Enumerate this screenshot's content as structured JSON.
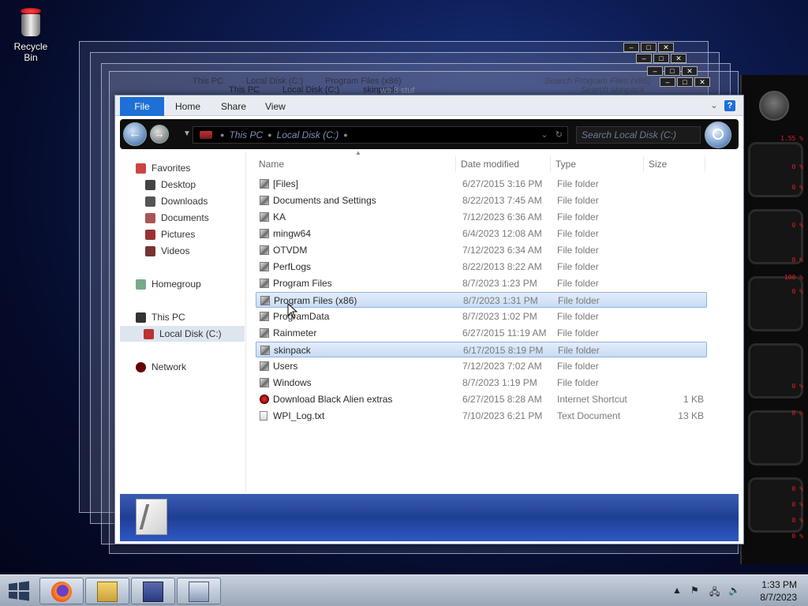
{
  "desktop": {
    "recycle_bin_label": "Recycle Bin"
  },
  "ghost_windows": {
    "crumb_this_pc": "This PC",
    "crumb_local_disk": "Local Disk (C:)",
    "crumb_program_files": "Program Files (x86)",
    "crumb_skinpack": "skinpack",
    "search_program_files": "Search Program Files (x86)",
    "search_skinpack": "Search skinpack",
    "partial_text": "ws 8 stuf"
  },
  "alien_panel": {
    "readouts": [
      "1.55 %",
      "0 %",
      "0 %",
      "0 %",
      "0 %",
      "100 %",
      "0 %",
      "0 %",
      "0 %",
      "0 %",
      "0 %",
      "0 %",
      "0 %",
      "0 %",
      "0 %",
      "0 %"
    ]
  },
  "ribbon": {
    "tabs": [
      "File",
      "Home",
      "Share",
      "View"
    ]
  },
  "nav": {
    "breadcrumbs": [
      "This PC",
      "Local Disk (C:)"
    ],
    "search_placeholder": "Search Local Disk (C:)"
  },
  "sidebar": {
    "favorites": "Favorites",
    "desktop": "Desktop",
    "downloads": "Downloads",
    "documents": "Documents",
    "pictures": "Pictures",
    "videos": "Videos",
    "homegroup": "Homegroup",
    "this_pc": "This PC",
    "local_disk": "Local Disk (C:)",
    "network": "Network"
  },
  "columns": {
    "name": "Name",
    "date": "Date modified",
    "type": "Type",
    "size": "Size"
  },
  "files": [
    {
      "name": "[Files]",
      "date": "6/27/2015 3:16 PM",
      "type": "File folder",
      "size": "",
      "icon": "folder-icon"
    },
    {
      "name": "Documents and Settings",
      "date": "8/22/2013 7:45 AM",
      "type": "File folder",
      "size": "",
      "icon": "folder-shortcut-icon"
    },
    {
      "name": "KA",
      "date": "7/12/2023 6:36 AM",
      "type": "File folder",
      "size": "",
      "icon": "folder-icon"
    },
    {
      "name": "mingw64",
      "date": "6/4/2023 12:08 AM",
      "type": "File folder",
      "size": "",
      "icon": "folder-icon"
    },
    {
      "name": "OTVDM",
      "date": "7/12/2023 6:34 AM",
      "type": "File folder",
      "size": "",
      "icon": "folder-icon"
    },
    {
      "name": "PerfLogs",
      "date": "8/22/2013 8:22 AM",
      "type": "File folder",
      "size": "",
      "icon": "folder-icon"
    },
    {
      "name": "Program Files",
      "date": "8/7/2023 1:23 PM",
      "type": "File folder",
      "size": "",
      "icon": "folder-icon"
    },
    {
      "name": "Program Files (x86)",
      "date": "8/7/2023 1:31 PM",
      "type": "File folder",
      "size": "",
      "icon": "folder-icon"
    },
    {
      "name": "ProgramData",
      "date": "8/7/2023 1:02 PM",
      "type": "File folder",
      "size": "",
      "icon": "folder-icon"
    },
    {
      "name": "Rainmeter",
      "date": "6/27/2015 11:19 AM",
      "type": "File folder",
      "size": "",
      "icon": "folder-icon"
    },
    {
      "name": "skinpack",
      "date": "6/17/2015 8:19 PM",
      "type": "File folder",
      "size": "",
      "icon": "folder-icon"
    },
    {
      "name": "Users",
      "date": "7/12/2023 7:02 AM",
      "type": "File folder",
      "size": "",
      "icon": "folder-icon"
    },
    {
      "name": "Windows",
      "date": "8/7/2023 1:19 PM",
      "type": "File folder",
      "size": "",
      "icon": "folder-icon"
    },
    {
      "name": "Download Black Alien extras",
      "date": "6/27/2015 8:28 AM",
      "type": "Internet Shortcut",
      "size": "1 KB",
      "icon": "internet-shortcut-icon"
    },
    {
      "name": "WPI_Log.txt",
      "date": "7/10/2023 6:21 PM",
      "type": "Text Document",
      "size": "13 KB",
      "icon": "text-file-icon"
    }
  ],
  "taskbar": {
    "time": "1:33 PM",
    "date": "8/7/2023"
  },
  "colors": {
    "accent": "#1e6fd6",
    "selection": "#c9dcf4",
    "alien_red": "#e02020"
  }
}
